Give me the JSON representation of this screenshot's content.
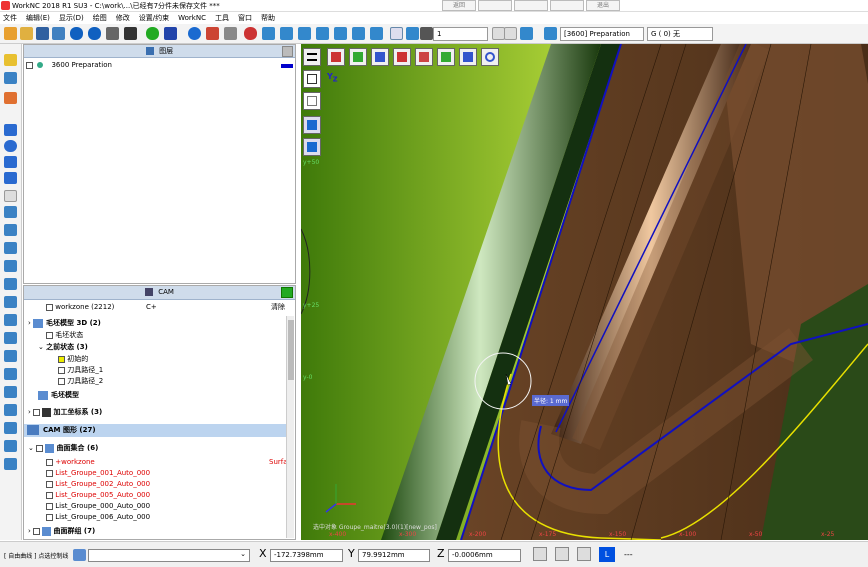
{
  "window": {
    "title": "WorkNC 2018 R1 SU3 - C:\\work\\...\\已经有7分件未保存文件 ***",
    "btn1": "返回",
    "btn2": "",
    "btn3": "",
    "btn4": "",
    "btn5": "退出"
  },
  "menu": [
    "文件",
    "编辑(E)",
    "显示(D)",
    "绘图",
    "修改",
    "设置/约束",
    "WorkNC",
    "工具",
    "窗口",
    "帮助"
  ],
  "toolbar": {
    "layer_num": "1",
    "layer_select": "[3600] Preparation",
    "group_select": "G ( 0) 无"
  },
  "layers": {
    "title": "图层",
    "rows": [
      {
        "label": "3600  Preparation"
      }
    ]
  },
  "cam": {
    "title": "CAM",
    "workzone": "workzone (2212)",
    "col_c": "C+",
    "col_d": "清除",
    "tree": [
      {
        "label": "毛坯模型 3D (2)",
        "bold": true
      },
      {
        "label": "毛坯状态"
      },
      {
        "label": "之前状态 (3)",
        "bold": true
      },
      {
        "label": "初始的"
      },
      {
        "label": "刀具路径_1"
      },
      {
        "label": "刀具路径_2"
      },
      {
        "label": "毛坯模型",
        "bold": true
      },
      {
        "label": "加工坐标系 (3)",
        "bold": true
      }
    ],
    "cam_graphics": "CAM 图形 (27)",
    "surface_set": "曲面集合 (6)",
    "surface_items": [
      "+workzone",
      "List_Groupe_001_Auto_000",
      "List_Groupe_002_Auto_000",
      "List_Groupe_005_Auto_000",
      "List_Groupe_000_Auto_000",
      "List_Groupe_006_Auto_000"
    ],
    "surface_tag": "Surfa",
    "surface_group": "曲面群组 (7)"
  },
  "viewport": {
    "tooltip": "半径: 1 mm",
    "status_text": "选中对象  Groupe_maitre(3.0)(1)[new_pos]",
    "ticks": [
      "x-400",
      "x-300",
      "x-200",
      "x-175",
      "x-150",
      "x-100",
      "x-50",
      "x-25"
    ],
    "side_ticks": [
      "y+50",
      "y+25",
      "y-0"
    ]
  },
  "status": {
    "mode": "[ 自由曲线 ]  点选控制线",
    "x_label": "X",
    "x_value": "-172.7398mm",
    "y_label": "Y",
    "y_value": "79.9912mm",
    "z_label": "Z",
    "z_value": "-0.0006mm",
    "l_badge": "L",
    "dashes": "---"
  }
}
